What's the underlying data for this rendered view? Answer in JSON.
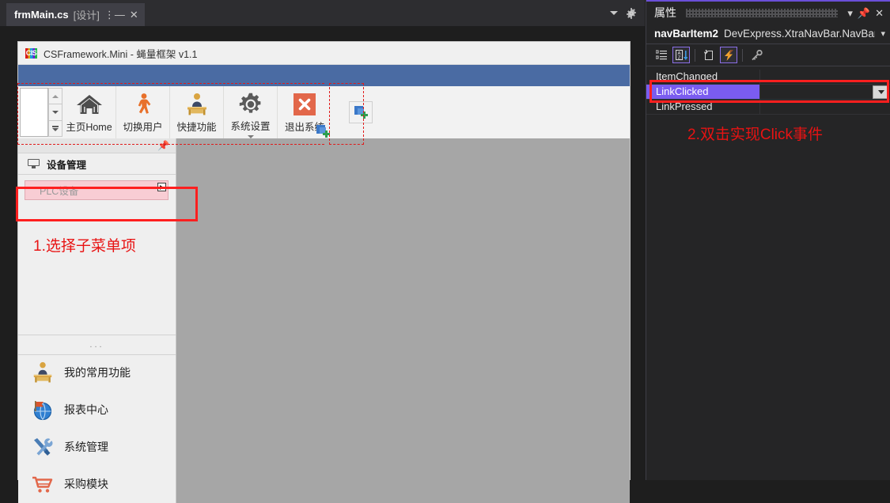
{
  "ide": {
    "tab": {
      "name": "frmMain.cs",
      "suffix": "[设计]",
      "pin_icon": "pin-icon",
      "close_icon": "close-icon"
    },
    "tabstrip_right": {
      "dropdown_icon": "chevron-down-icon",
      "settings_icon": "gear-icon"
    }
  },
  "form": {
    "title": "CSFramework.Mini - 蝇量框架 v1.1",
    "logo_text": "CIS",
    "ribbon": {
      "buttons": [
        {
          "label": "主页Home",
          "icon": "home-icon"
        },
        {
          "label": "切换用户",
          "icon": "person-walking-icon"
        },
        {
          "label": "快捷功能",
          "icon": "desk-person-icon"
        },
        {
          "label": "系统设置",
          "icon": "gear-icon",
          "has_dropdown": true
        },
        {
          "label": "退出系统",
          "icon": "close-x-icon"
        }
      ],
      "add_tile_icon": "add-item-icon",
      "corner_add_icon": "add-item-icon"
    },
    "nav": {
      "pin_icon": "pin-icon",
      "group_header": {
        "label": "设备管理",
        "icon": "monitor-icon"
      },
      "selected_item": {
        "label": "PLC设备",
        "marker_icon": "play-arrow-icon"
      },
      "ellipsis": "...",
      "items": [
        {
          "label": "我的常用功能",
          "icon": "desk-person-icon"
        },
        {
          "label": "报表中心",
          "icon": "globe-flag-icon"
        },
        {
          "label": "系统管理",
          "icon": "tools-icon"
        },
        {
          "label": "采购模块",
          "icon": "shopping-cart-icon"
        }
      ]
    }
  },
  "annotations": {
    "step1": "1.选择子菜单项",
    "step2": "2.双击实现Click事件"
  },
  "properties": {
    "panel_title": "属性",
    "dropdown_icon": "chevron-down-icon",
    "pin_icon": "pin-icon",
    "close_icon": "close-icon",
    "object_name": "navBarItem2",
    "object_type": "DevExpress.XtraNavBar.NavBarIte",
    "object_dropdown_icon": "chevron-down-icon",
    "toolbar": [
      {
        "name": "categorized-button",
        "icon": "categorized-icon",
        "active": false
      },
      {
        "name": "alphabetical-button",
        "icon": "sort-az-icon",
        "active": true
      },
      {
        "name": "properties-button",
        "icon": "properties-icon",
        "active": false
      },
      {
        "name": "events-button",
        "icon": "lightning-icon",
        "active": true
      },
      {
        "name": "property-pages-button",
        "icon": "key-icon",
        "active": false
      }
    ],
    "events": [
      {
        "name": "ItemChanged",
        "value": "",
        "selected": false
      },
      {
        "name": "LinkClicked",
        "value": "",
        "selected": true
      },
      {
        "name": "LinkPressed",
        "value": "",
        "selected": false
      }
    ],
    "combo_icon": "chevron-down-icon",
    "colors": {
      "selection": "#7a5cf0",
      "accent": "#6a4fd8",
      "annotation": "#ff1f1f"
    }
  }
}
